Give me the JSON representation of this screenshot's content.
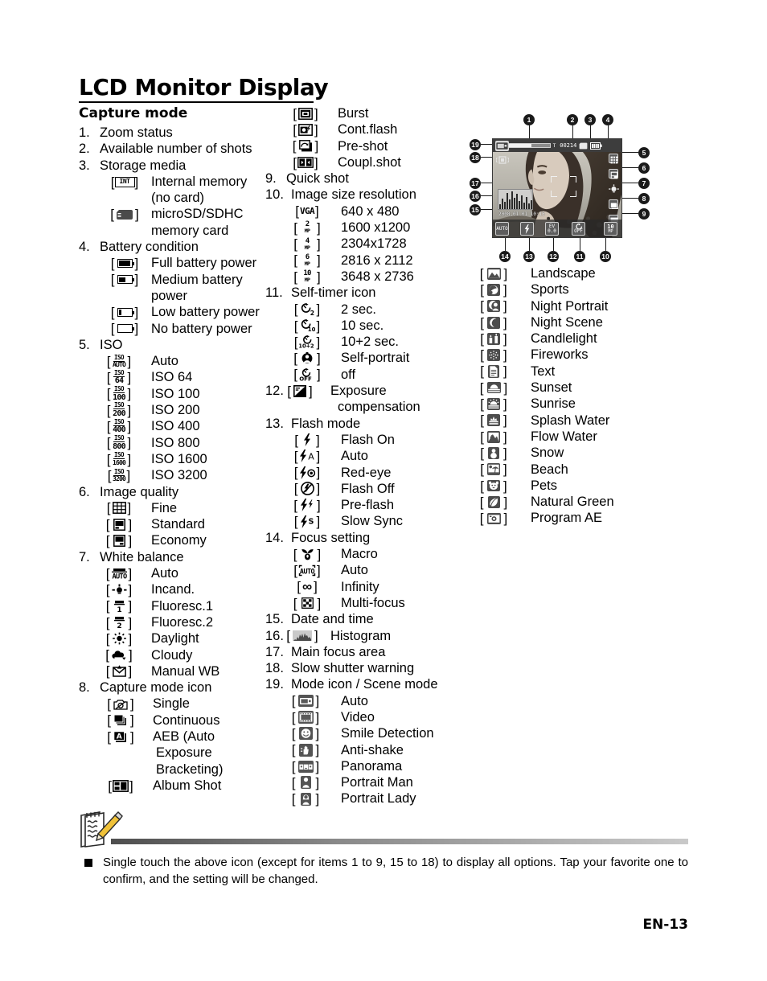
{
  "page": {
    "title": "LCD Monitor Display",
    "page_number": "EN-13"
  },
  "sections": {
    "capture_mode_heading": "Capture mode"
  },
  "items": {
    "n1": {
      "num": "1.",
      "label": "Zoom status"
    },
    "n2": {
      "num": "2.",
      "label": "Available number of shots"
    },
    "n3": {
      "num": "3.",
      "label": "Storage media"
    },
    "n3_sub": [
      {
        "icon": "internal-memory-icon",
        "label": "Internal memory",
        "label2": "(no card)"
      },
      {
        "icon": "microsd-card-icon",
        "label": "microSD/SDHC",
        "label2": "memory card"
      }
    ],
    "n4": {
      "num": "4.",
      "label": "Battery condition"
    },
    "n4_sub": [
      {
        "icon": "battery-full-icon",
        "label": "Full battery power"
      },
      {
        "icon": "battery-medium-icon",
        "label": "Medium battery",
        "label2": "power"
      },
      {
        "icon": "battery-low-icon",
        "label": "Low battery power"
      },
      {
        "icon": "battery-empty-icon",
        "label": "No battery power"
      }
    ],
    "n5": {
      "num": "5.",
      "label": "ISO"
    },
    "n5_sub": [
      {
        "icon": "iso-auto-icon",
        "value": "AUTO",
        "label": "Auto"
      },
      {
        "icon": "iso-64-icon",
        "value": "64",
        "label": "ISO  64"
      },
      {
        "icon": "iso-100-icon",
        "value": "100",
        "label": "ISO  100"
      },
      {
        "icon": "iso-200-icon",
        "value": "200",
        "label": "ISO  200"
      },
      {
        "icon": "iso-400-icon",
        "value": "400",
        "label": "ISO  400"
      },
      {
        "icon": "iso-800-icon",
        "value": "800",
        "label": "ISO  800"
      },
      {
        "icon": "iso-1600-icon",
        "value": "1600",
        "label": "ISO  1600"
      },
      {
        "icon": "iso-3200-icon",
        "value": "3200",
        "label": "ISO  3200"
      }
    ],
    "n6": {
      "num": "6.",
      "label": "Image quality"
    },
    "n6_sub": [
      {
        "icon": "quality-fine-icon",
        "label": "Fine"
      },
      {
        "icon": "quality-standard-icon",
        "label": "Standard"
      },
      {
        "icon": "quality-economy-icon",
        "label": "Economy"
      }
    ],
    "n7": {
      "num": "7.",
      "label": "White balance"
    },
    "n7_sub": [
      {
        "icon": "wb-auto-icon",
        "label": "Auto"
      },
      {
        "icon": "wb-incandescent-icon",
        "label": "Incand."
      },
      {
        "icon": "wb-fluorescent-1-icon",
        "label": "Fluoresc.1"
      },
      {
        "icon": "wb-fluorescent-2-icon",
        "label": "Fluoresc.2"
      },
      {
        "icon": "wb-daylight-icon",
        "label": "Daylight"
      },
      {
        "icon": "wb-cloudy-icon",
        "label": "Cloudy"
      },
      {
        "icon": "wb-manual-icon",
        "label": "Manual WB"
      }
    ],
    "n8": {
      "num": "8.",
      "label": "Capture mode icon"
    },
    "n8_sub": [
      {
        "icon": "capture-single-icon",
        "label": "Single"
      },
      {
        "icon": "capture-continuous-icon",
        "label": "Continuous"
      },
      {
        "icon": "capture-aeb-icon",
        "label": "AEB (Auto",
        "label2": "Exposure",
        "label3": "Bracketing)"
      },
      {
        "icon": "capture-album-shot-icon",
        "label": "Album Shot"
      },
      {
        "icon": "capture-burst-icon",
        "label": "Burst"
      },
      {
        "icon": "capture-cont-flash-icon",
        "label": "Cont.flash"
      },
      {
        "icon": "capture-pre-shot-icon",
        "label": "Pre-shot"
      },
      {
        "icon": "capture-coupl-shot-icon",
        "label": "Coupl.shot"
      }
    ],
    "n9": {
      "num": "9.",
      "label": "Quick shot"
    },
    "n10": {
      "num": "10.",
      "label": "Image size resolution"
    },
    "n10_sub": [
      {
        "icon": "size-vga-icon",
        "badge": "VGA",
        "label": "640 x 480"
      },
      {
        "icon": "size-2mp-icon",
        "badge": "2",
        "unit": "MP",
        "label": "1600 x1200"
      },
      {
        "icon": "size-4mp-icon",
        "badge": "4",
        "unit": "MP",
        "label": "2304x1728"
      },
      {
        "icon": "size-6mp-icon",
        "badge": "6",
        "unit": "MP",
        "label": "2816 x 2112"
      },
      {
        "icon": "size-10mp-icon",
        "badge": "10",
        "unit": "MP",
        "label": "3648 x 2736"
      }
    ],
    "n11": {
      "num": "11.",
      "label": "Self-timer icon"
    },
    "n11_sub": [
      {
        "icon": "timer-2sec-icon",
        "badge": "2",
        "label": "2 sec."
      },
      {
        "icon": "timer-10sec-icon",
        "badge": "10",
        "label": "10 sec."
      },
      {
        "icon": "timer-10plus2sec-icon",
        "badge": "10+2",
        "label": "10+2 sec."
      },
      {
        "icon": "timer-self-portrait-icon",
        "label": "Self-portrait"
      },
      {
        "icon": "timer-off-icon",
        "badge": "OFF",
        "label": "off"
      }
    ],
    "n12": {
      "num": "12.",
      "icon": "exposure-compensation-icon",
      "label": "Exposure",
      "label2": "compensation"
    },
    "n13": {
      "num": "13.",
      "label": "Flash  mode"
    },
    "n13_sub": [
      {
        "icon": "flash-on-icon",
        "label": "Flash On"
      },
      {
        "icon": "flash-auto-icon",
        "label": "Auto"
      },
      {
        "icon": "flash-red-eye-icon",
        "label": "Red-eye"
      },
      {
        "icon": "flash-off-icon",
        "label": "Flash Off"
      },
      {
        "icon": "flash-pre-flash-icon",
        "label": "Pre-flash"
      },
      {
        "icon": "flash-slow-sync-icon",
        "label": "Slow Sync"
      }
    ],
    "n14": {
      "num": "14.",
      "label": "Focus setting"
    },
    "n14_sub": [
      {
        "icon": "focus-macro-icon",
        "label": "Macro"
      },
      {
        "icon": "focus-auto-icon",
        "label": "Auto"
      },
      {
        "icon": "focus-infinity-icon",
        "label": "Infinity"
      },
      {
        "icon": "focus-multi-icon",
        "label": "Multi-focus"
      }
    ],
    "n15": {
      "num": "15.",
      "label": "Date and time"
    },
    "n16": {
      "num": "16.",
      "icon": "histogram-icon",
      "label": "Histogram"
    },
    "n17": {
      "num": "17.",
      "label": "Main focus area"
    },
    "n18": {
      "num": "18.",
      "label": "Slow shutter warning"
    },
    "n19": {
      "num": "19.",
      "label": "Mode icon / Scene  mode"
    },
    "n19_sub": [
      {
        "icon": "mode-auto-icon",
        "label": "Auto"
      },
      {
        "icon": "mode-video-icon",
        "label": "Video"
      },
      {
        "icon": "mode-smile-detection-icon",
        "label": "Smile Detection"
      },
      {
        "icon": "mode-anti-shake-icon",
        "label": "Anti-shake"
      },
      {
        "icon": "mode-panorama-icon",
        "label": "Panorama"
      },
      {
        "icon": "mode-portrait-man-icon",
        "label": "Portrait Man"
      },
      {
        "icon": "mode-portrait-lady-icon",
        "label": "Portrait Lady"
      }
    ],
    "scene_modes": [
      {
        "icon": "scene-landscape-icon",
        "label": "Landscape"
      },
      {
        "icon": "scene-sports-icon",
        "label": "Sports"
      },
      {
        "icon": "scene-night-portrait-icon",
        "label": "Night Portrait"
      },
      {
        "icon": "scene-night-scene-icon",
        "label": "Night Scene"
      },
      {
        "icon": "scene-candlelight-icon",
        "label": "Candlelight"
      },
      {
        "icon": "scene-fireworks-icon",
        "label": "Fireworks"
      },
      {
        "icon": "scene-text-icon",
        "label": "Text"
      },
      {
        "icon": "scene-sunset-icon",
        "label": "Sunset"
      },
      {
        "icon": "scene-sunrise-icon",
        "label": "Sunrise"
      },
      {
        "icon": "scene-splash-water-icon",
        "label": "Splash Water"
      },
      {
        "icon": "scene-flow-water-icon",
        "label": "Flow Water"
      },
      {
        "icon": "scene-snow-icon",
        "label": "Snow"
      },
      {
        "icon": "scene-beach-icon",
        "label": "Beach"
      },
      {
        "icon": "scene-pets-icon",
        "label": "Pets"
      },
      {
        "icon": "scene-natural-green-icon",
        "label": "Natural Green"
      },
      {
        "icon": "scene-program-ae-icon",
        "label": "Program AE"
      }
    ]
  },
  "diagram": {
    "callouts": [
      "1",
      "2",
      "3",
      "4",
      "5",
      "6",
      "7",
      "8",
      "9",
      "10",
      "11",
      "12",
      "13",
      "14",
      "15",
      "16",
      "17",
      "18",
      "19"
    ],
    "osd": {
      "shots_remaining": "00214",
      "date_time": "2008.01.01 10:15",
      "focus_label": "AUTO",
      "ev_label": "EV",
      "ev_value": "0.0",
      "timer_label": "OFF",
      "size_value": "10",
      "size_unit": "MP"
    }
  },
  "note": {
    "icon": "note-pencil-icon",
    "text": "Single touch the above icon (except for items 1 to 9, 15 to 18) to display all options. Tap your favorite one to confirm, and the setting will be changed."
  }
}
